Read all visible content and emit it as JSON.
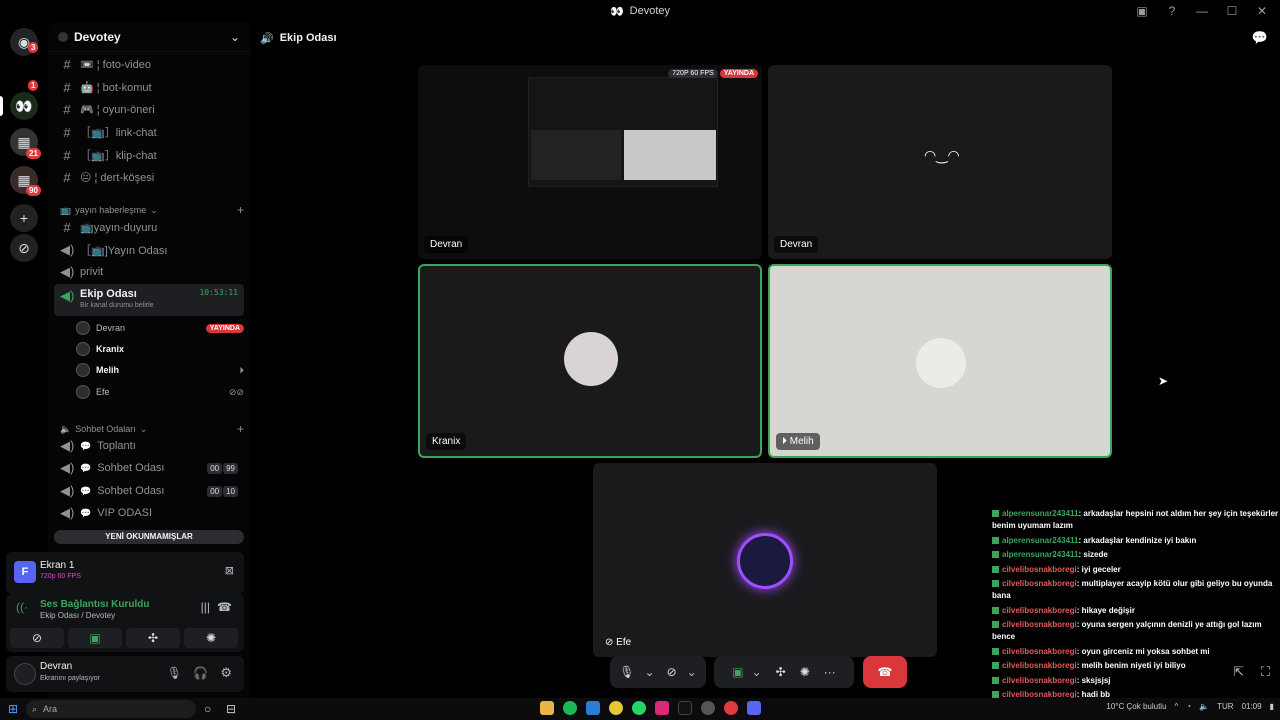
{
  "window": {
    "title": "Devotey"
  },
  "rail": {
    "badges": [
      "3",
      "1",
      "21",
      "90"
    ]
  },
  "sidebar": {
    "server_name": "Devotey",
    "channels_top": [
      {
        "icon": "#",
        "label": "📼 ¦ foto-video"
      },
      {
        "icon": "#",
        "label": "🤖 ¦ bot-komut"
      },
      {
        "icon": "#",
        "label": "🎮 ¦ oyun-öneri"
      },
      {
        "icon": "#",
        "label": "［📺］link-chat"
      },
      {
        "icon": "#",
        "label": "［📺］klip-chat"
      },
      {
        "icon": "#",
        "label": "😐 ¦ dert-köşesi"
      }
    ],
    "category1": "yayın haberleşme",
    "channels_cat1": [
      {
        "icon": "#",
        "label": "📺yayın-duyuru"
      },
      {
        "icon": "🔊",
        "label": "［📺]Yayın Odası"
      },
      {
        "icon": "🔊",
        "label": "privit"
      }
    ],
    "active_channel": {
      "label": "Ekip Odası",
      "timer": "10:53:11",
      "status": "Bir kanal durumu belirle"
    },
    "members": [
      {
        "name": "Devran",
        "live": "YAYINDA"
      },
      {
        "name": "Kranix"
      },
      {
        "name": "Melih"
      },
      {
        "name": "Efe"
      }
    ],
    "category2": "Sohbet Odaları",
    "channels_cat2": [
      {
        "label": "Toplantı"
      },
      {
        "label": "Sohbet Odası",
        "pill": [
          "00",
          "99"
        ]
      },
      {
        "label": "Sohbet Odası",
        "pill": [
          "00",
          "10"
        ]
      },
      {
        "label": "VIP ODASI"
      }
    ],
    "unread_label": "YENİ OKUNMAMIŞLAR"
  },
  "stream_card": {
    "title": "Ekran 1",
    "sub": "720p 60 FPS"
  },
  "voice_card": {
    "title": "Ses Bağlantısı Kuruldu",
    "sub": "Ekip Odası / Devotey"
  },
  "user_card": {
    "name": "Devran",
    "status": "Ekranını paylaşıyor"
  },
  "main": {
    "channel_title": "Ekip Odası",
    "stream_badge": "720P 60 FPS",
    "stream_live": "YAYINDA",
    "tiles": [
      {
        "label": "Devran"
      },
      {
        "label": "Devran"
      },
      {
        "label": "Kranix"
      },
      {
        "label": "Melih"
      },
      {
        "label": "Efe"
      }
    ]
  },
  "chat": [
    {
      "user": "alperensunar243411",
      "cls": "u1",
      "text": ": arkadaşlar hepsini not aldım her şey için teşekürler benim uyumam lazım"
    },
    {
      "user": "alperensunar243411",
      "cls": "u1",
      "text": ": arkadaşlar kendinize iyi bakın"
    },
    {
      "user": "alperensunar243411",
      "cls": "u1",
      "text": ": sizede"
    },
    {
      "user": "cilvelibosnakboregi",
      "cls": "u2",
      "text": ": iyi geceler"
    },
    {
      "user": "cilvelibosnakboregi",
      "cls": "u2",
      "text": ": multiplayer acayip kötü olur gibi geliyo bu oyunda bana"
    },
    {
      "user": "cilvelibosnakboregi",
      "cls": "u2",
      "text": ": hikaye değişir"
    },
    {
      "user": "cilvelibosnakboregi",
      "cls": "u2",
      "text": ": oyuna sergen yalçının denizli ye attığı gol lazım bence"
    },
    {
      "user": "cilvelibosnakboregi",
      "cls": "u2",
      "text": ": oyun girceniz mi yoksa sohbet mi"
    },
    {
      "user": "cilvelibosnakboregi",
      "cls": "u2",
      "text": ": melih benim niyeti iyi biliyo"
    },
    {
      "user": "cilvelibosnakboregi",
      "cls": "u2",
      "text": ": sksjsjsj"
    },
    {
      "user": "cilvelibosnakboregi",
      "cls": "u2",
      "text": ": hadi bb"
    }
  ],
  "taskbar": {
    "search_placeholder": "Ara",
    "weather": "10°C Çok bulutlu",
    "lang": "TUR",
    "time": "01:09"
  }
}
